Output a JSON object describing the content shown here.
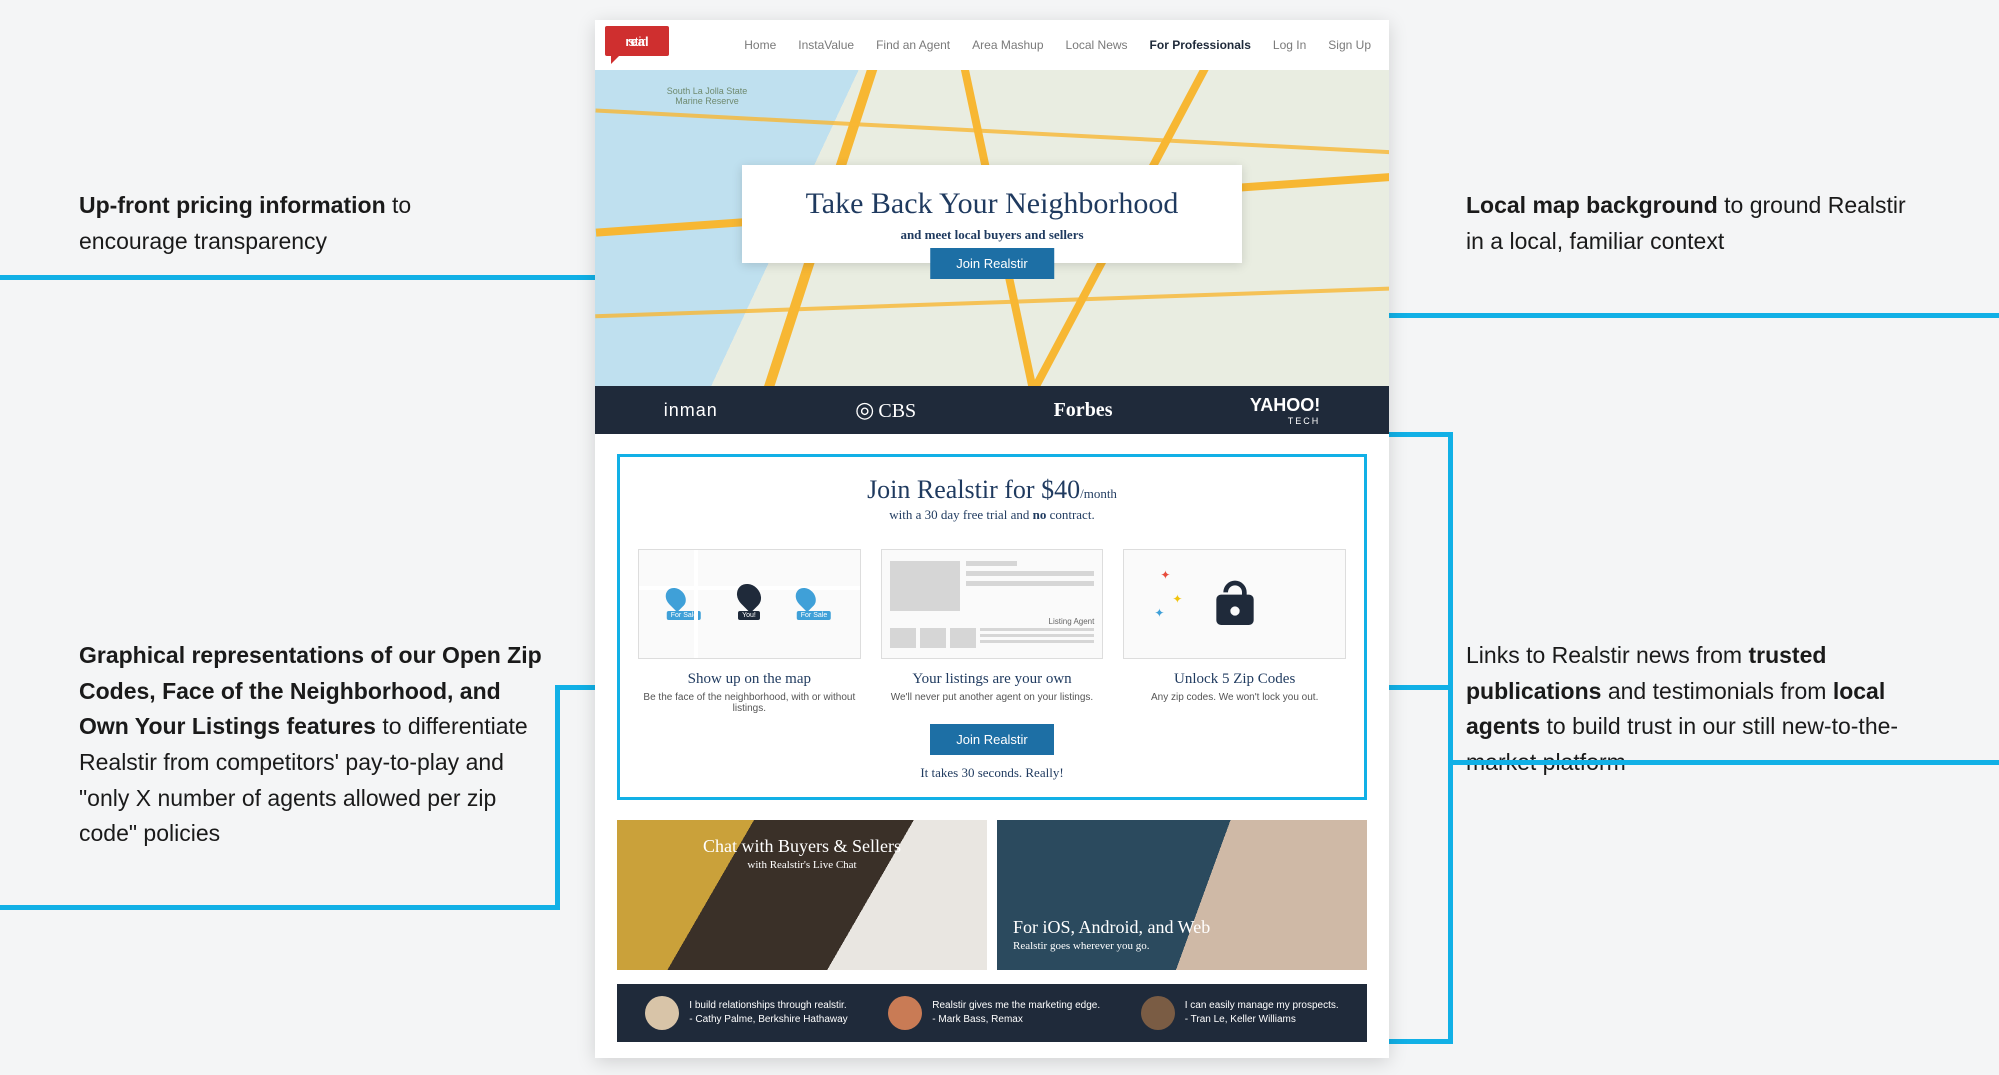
{
  "annotations": {
    "top_left": {
      "bold": "Up-front pricing information",
      "rest": " to encourage transparency"
    },
    "mid_left": {
      "bold_prefix": "Graphical representations of our Open Zip Codes, Face of the Neighborhood, and Own Your Listings features",
      "rest": " to differentiate Realstir from competitors' pay-to-play and \"only X number of agents allowed per zip code\" policies"
    },
    "top_right": {
      "bold": "Local map background",
      "rest": " to ground Realstir in a local, familiar context"
    },
    "mid_right": {
      "prefix": "Links to Realstir news from ",
      "bold1": "trusted publications",
      "mid": " and testimonials from ",
      "bold2": "local agents",
      "rest": " to build trust in our still new-to-the-market platform"
    }
  },
  "logo": {
    "bold": "real",
    "light": "stir"
  },
  "nav": [
    "Home",
    "InstaValue",
    "Find an Agent",
    "Area Mashup",
    "Local News",
    "For Professionals",
    "Log In",
    "Sign Up"
  ],
  "nav_active_index": 5,
  "hero": {
    "park_label": "South La Jolla State Marine Reserve",
    "title": "Take Back Your Neighborhood",
    "subtitle": "and meet local buyers and sellers",
    "cta": "Join Realstir"
  },
  "press": [
    "inman",
    "CBS",
    "Forbes",
    "YAHOO!",
    "TECH"
  ],
  "pricing": {
    "title_pre": "Join Realstir for ",
    "title_price": "$40",
    "title_per": "/month",
    "sub_pre": "with a 30 day free trial and ",
    "sub_bold": "no",
    "sub_post": " contract.",
    "cta": "Join Realstir",
    "thirty": "It takes 30 seconds.  Really!"
  },
  "pins": {
    "left": "For Sale",
    "mid": "You!",
    "right": "For Sale"
  },
  "features": [
    {
      "title": "Show up on the map",
      "desc": "Be the face of the neighborhood, with or without listings."
    },
    {
      "title": "Your listings are your own",
      "desc": "We'll never put another agent on your listings.",
      "agent": "Listing Agent"
    },
    {
      "title": "Unlock 5 Zip Codes",
      "desc": "Any zip codes.  We won't lock you out."
    }
  ],
  "panels": [
    {
      "title": "Chat with Buyers & Sellers",
      "sub": "with Realstir's Live Chat"
    },
    {
      "title": "For iOS, Android, and Web",
      "sub": "Realstir goes wherever you go."
    }
  ],
  "testimonials": [
    {
      "quote": "I build relationships through realstir.",
      "by": "- Cathy Palme, Berkshire Hathaway"
    },
    {
      "quote": "Realstir gives me the marketing edge.",
      "by": "- Mark Bass, Remax"
    },
    {
      "quote": "I can easily manage my prospects.",
      "by": "- Tran Le, Keller Williams"
    }
  ]
}
